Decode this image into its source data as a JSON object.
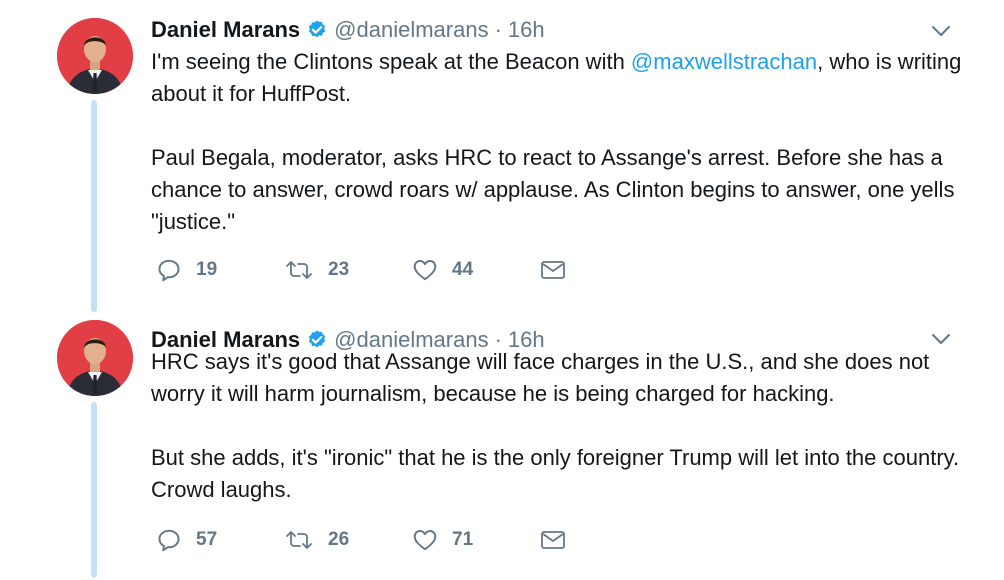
{
  "tweets": [
    {
      "author": {
        "name": "Daniel Marans",
        "handle": "@danielmarans",
        "verified": true
      },
      "separator": "·",
      "time": "16h",
      "paragraphs": [
        {
          "before_mention": "I'm seeing the Clintons speak at the Beacon with ",
          "mention": "@maxwellstrachan",
          "after_mention": ", who is writing about it for HuffPost."
        },
        {
          "text": "Paul Begala, moderator, asks HRC to react to Assange's arrest. Before she has a chance to answer, crowd roars w/ applause. As Clinton begins to answer, one yells \"justice.\""
        }
      ],
      "replies": "19",
      "retweets": "23",
      "likes": "44"
    },
    {
      "author": {
        "name": "Daniel Marans",
        "handle": "@danielmarans",
        "verified": true
      },
      "separator": "·",
      "time": "16h",
      "paragraphs": [
        {
          "text": "HRC says it's good that Assange will face charges in the U.S., and she does not worry it will harm journalism, because he is being charged for hacking."
        },
        {
          "text": "But she adds, it's \"ironic\" that he is the only foreigner Trump will let into the country. Crowd laughs."
        }
      ],
      "replies": "57",
      "retweets": "26",
      "likes": "71"
    }
  ],
  "icons": {
    "verified": "verified-badge-icon",
    "caret": "chevron-down-icon",
    "reply": "reply-icon",
    "retweet": "retweet-icon",
    "like": "heart-icon",
    "dm": "envelope-icon"
  },
  "colors": {
    "link": "#1da1f2",
    "secondary_text": "#657786",
    "thread_line": "#c4e1f5",
    "avatar_background": "#e13f45"
  }
}
